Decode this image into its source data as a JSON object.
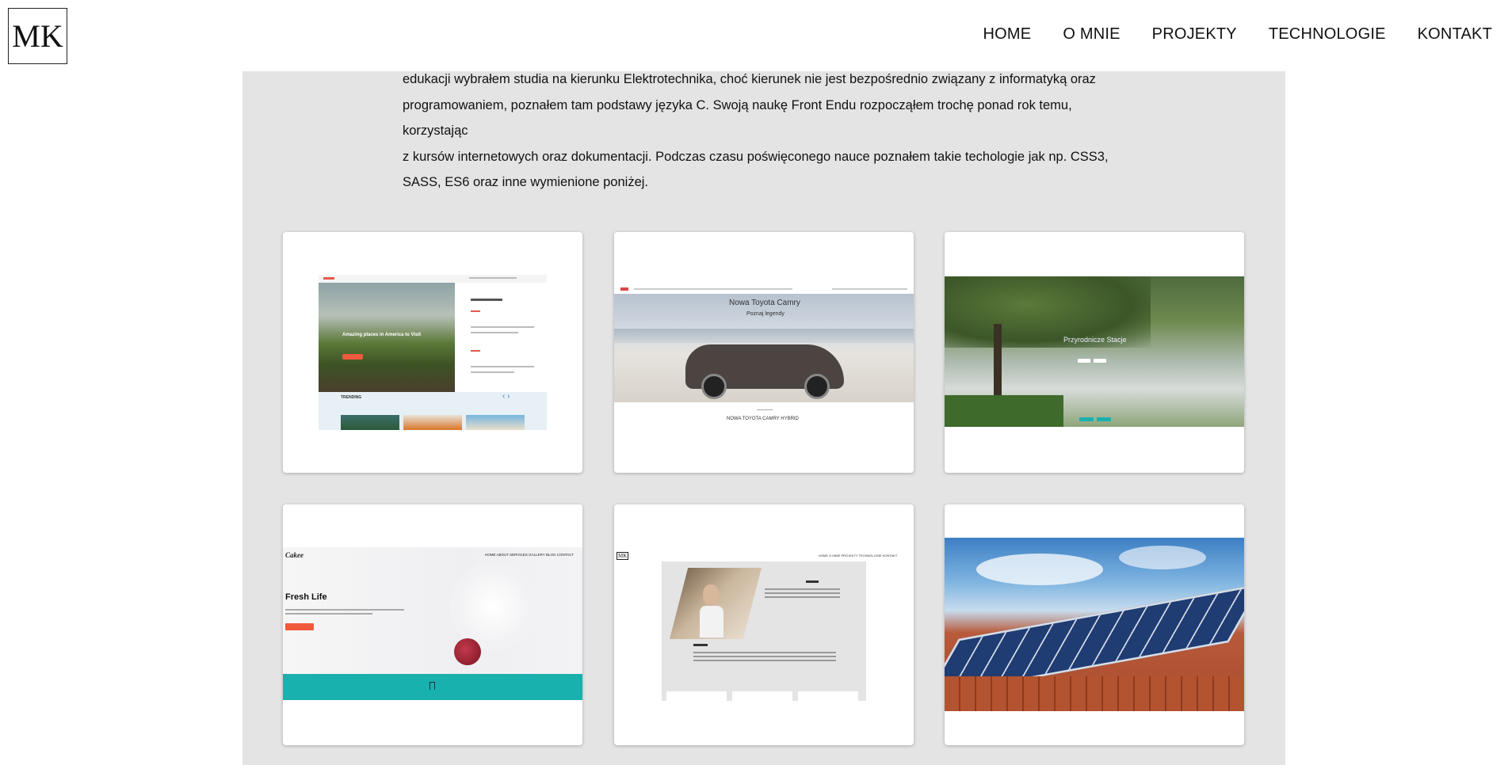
{
  "logo": {
    "text": "MK"
  },
  "nav": {
    "items": [
      "HOME",
      "O MNIE",
      "PROJEKTY",
      "TECHNOLOGIE",
      "KONTAKT"
    ]
  },
  "about": {
    "lines": [
      "edukacji wybrałem studia na kierunku Elektrotechnika, choć kierunek nie jest bezpośrednio związany z informatyką oraz",
      "programowaniem, poznałem tam podstawy języka C. Swoją naukę Front Endu rozpocząłem trochę ponad rok temu, korzystając",
      "z kursów internetowych oraz dokumentacji. Podczas czasu poświęconego nauce poznałem takie techologie jak np. CSS3,",
      "SASS, ES6 oraz inne wymienione poniżej."
    ]
  },
  "projects": {
    "p1": {
      "card_title": "Amazing places in America to Visit",
      "trending": "TRENDING"
    },
    "p2": {
      "title": "Nowa Toyota Camry",
      "subtitle": "Poznaj legendy",
      "footer": "NOWA TOYOTA CAMRY HYBRID"
    },
    "p3": {
      "title": "Przyrodnicze Stacje"
    },
    "p4": {
      "brand": "Cakee",
      "nav": "HOME  ABOUT  SERVICES  GALLERY  BLOG  CONTACT",
      "headline": "Fresh Life"
    },
    "p5": {
      "brand": "MK",
      "nav": "HOME  O MNIE  PROJEKTY  TECHNOLOGIE  KONTAKT"
    },
    "p6": {}
  },
  "colors": {
    "section_bg": "#e4e4e4",
    "accent_red": "#f05a3c",
    "teal": "#19b1ad"
  }
}
